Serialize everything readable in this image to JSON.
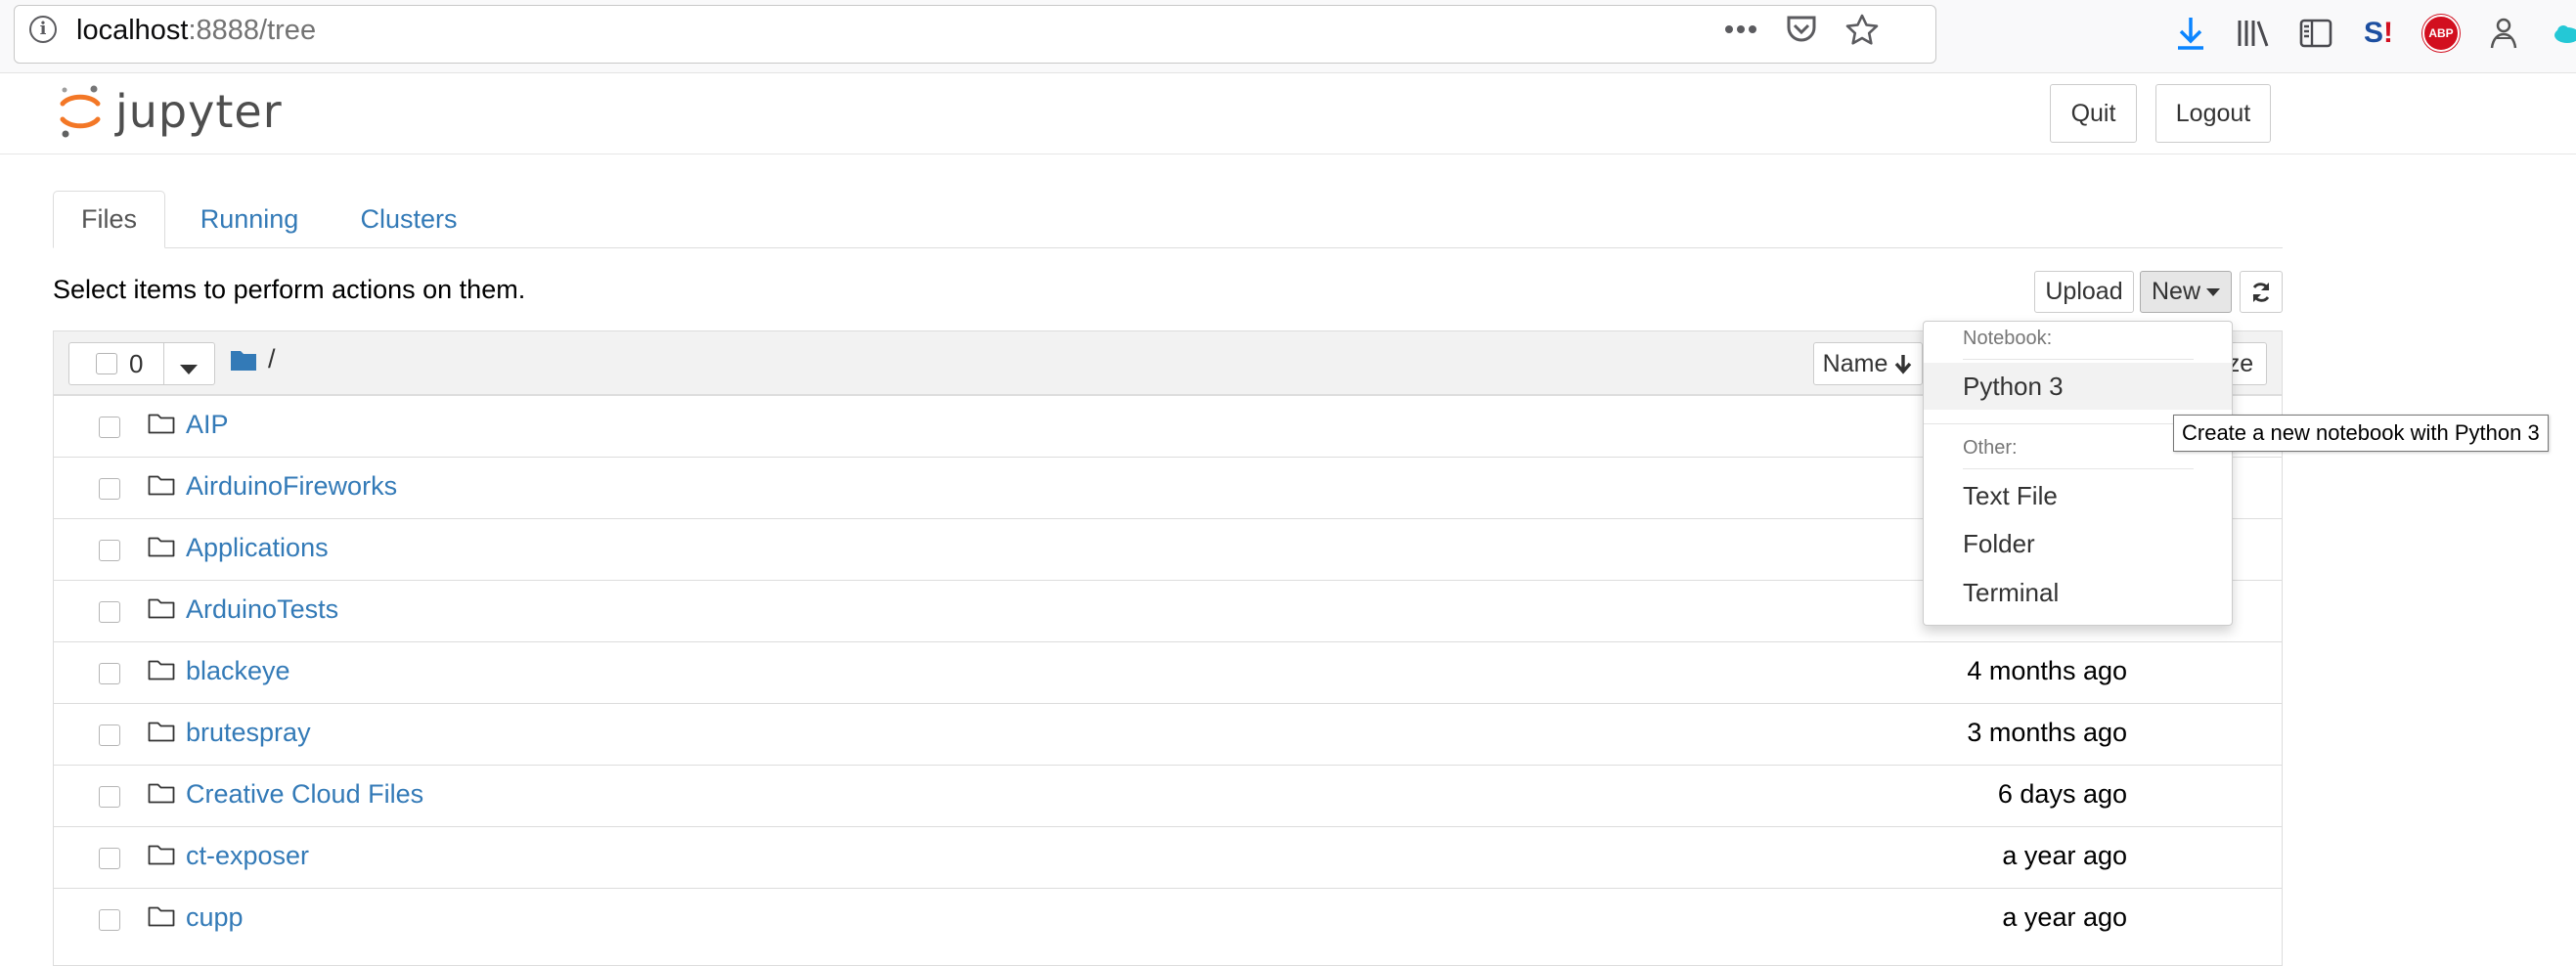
{
  "browser": {
    "url_host": "localhost",
    "url_rest": ":8888/tree",
    "toolbar_icons": [
      "page-actions-icon",
      "pocket-icon",
      "bookmark-star-icon"
    ],
    "extension_icons": [
      "download-icon",
      "library-icon",
      "sidebar-icon",
      "s-extension-icon",
      "adblock-plus-icon",
      "extension-figure-icon",
      "cloud-icon"
    ],
    "abp_label": "ABP",
    "s_label": "S"
  },
  "header": {
    "logo_text": "jupyter",
    "quit_label": "Quit",
    "logout_label": "Logout"
  },
  "tabs": [
    {
      "label": "Files",
      "active": true
    },
    {
      "label": "Running",
      "active": false
    },
    {
      "label": "Clusters",
      "active": false
    }
  ],
  "toolbar": {
    "hint": "Select items to perform actions on them.",
    "upload_label": "Upload",
    "new_label": "New"
  },
  "list_header": {
    "selected_count": "0",
    "breadcrumb": "/",
    "sort_name_label": "Name",
    "sort_size_label": "ze"
  },
  "new_menu": {
    "notebook_header": "Notebook:",
    "python_label": "Python 3",
    "other_header": "Other:",
    "items": [
      "Text File",
      "Folder",
      "Terminal"
    ]
  },
  "tooltip": "Create a new notebook with Python 3",
  "files": [
    {
      "name": "AIP",
      "modified": ""
    },
    {
      "name": "AirduinoFireworks",
      "modified": ""
    },
    {
      "name": "Applications",
      "modified": ""
    },
    {
      "name": "ArduinoTests",
      "modified": ""
    },
    {
      "name": "blackeye",
      "modified": "4 months ago"
    },
    {
      "name": "brutespray",
      "modified": "3 months ago"
    },
    {
      "name": "Creative Cloud Files",
      "modified": "6 days ago"
    },
    {
      "name": "ct-exposer",
      "modified": "a year ago"
    },
    {
      "name": "cupp",
      "modified": "a year ago"
    }
  ],
  "colors": {
    "link": "#337ab7",
    "jupyter_orange": "#f37726",
    "download_blue": "#0a84ff"
  }
}
